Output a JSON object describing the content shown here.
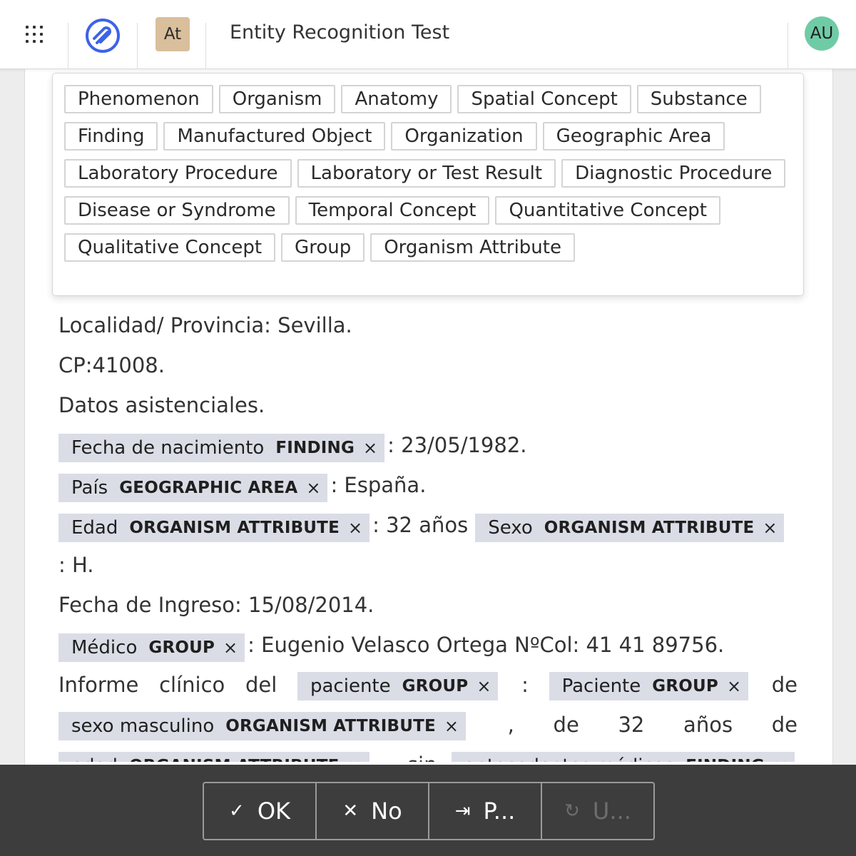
{
  "header": {
    "project_title": "Entity Recognition Test",
    "workspace_badge": "At",
    "user_initials": "AU"
  },
  "label_picker": {
    "labels": [
      "Phenomenon",
      "Organism",
      "Anatomy",
      "Spatial Concept",
      "Substance",
      "Finding",
      "Manufactured Object",
      "Organization",
      "Geographic Area",
      "Laboratory Procedure",
      "Laboratory or Test Result",
      "Diagnostic Procedure",
      "Disease or Syndrome",
      "Temporal Concept",
      "Quantitative Concept",
      "Qualitative Concept",
      "Group",
      "Organism Attribute"
    ]
  },
  "document": {
    "localidad": "Localidad/ Provincia: Sevilla.",
    "cp": "CP:41008.",
    "datos": "Datos asistenciales.",
    "e_fecha": {
      "text": "Fecha de nacimiento",
      "label": "FINDING"
    },
    "fecha_value": ": 23/05/1982.",
    "e_pais": {
      "text": "País",
      "label": "GEOGRAPHIC AREA"
    },
    "pais_value": ": España.",
    "e_edad": {
      "text": "Edad",
      "label": "ORGANISM ATTRIBUTE"
    },
    "edad_value": ": 32 años",
    "e_sexo": {
      "text": "Sexo",
      "label": "ORGANISM ATTRIBUTE"
    },
    "sexo_value": ": H.",
    "ingreso": "Fecha de Ingreso: 15/08/2014.",
    "e_medico": {
      "text": "Médico",
      "label": "GROUP"
    },
    "medico_value": ": Eugenio Velasco Ortega NºCol: 41 41 89756.",
    "informe_w1": "Informe",
    "informe_w2": "clínico",
    "informe_w3": "del",
    "e_paciente1": {
      "text": "paciente",
      "label": "GROUP"
    },
    "colon": ":",
    "e_paciente2": {
      "text": "Paciente",
      "label": "GROUP"
    },
    "de1": "de",
    "e_sexo_masc": {
      "text": "sexo masculino",
      "label": "ORGANISM ATTRIBUTE"
    },
    "comma": ",",
    "de2": "de",
    "num32": "32",
    "anos": "años",
    "de3": "de",
    "e_edad2": {
      "text": "edad",
      "label": "ORGANISM ATTRIBUTE"
    },
    "comma2": ",",
    "sin": "sin",
    "e_antecedentes": {
      "text": "antecedentes médicos",
      "label": "FINDING"
    },
    "remove_symbol": "×"
  },
  "actions": {
    "ok": {
      "icon": "✓",
      "label": "OK"
    },
    "no": {
      "icon": "✕",
      "label": "No"
    },
    "p": {
      "icon": "⇥",
      "label": "P..."
    },
    "u": {
      "icon": "↻",
      "label": "U..."
    }
  }
}
